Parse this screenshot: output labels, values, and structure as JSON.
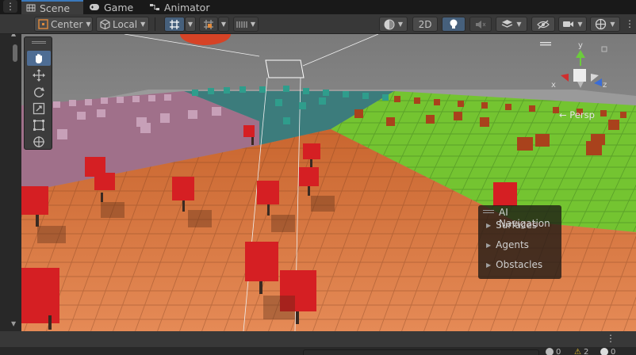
{
  "tabs": [
    {
      "label": "Scene",
      "icon": "scene-grid-icon",
      "active": true
    },
    {
      "label": "Game",
      "icon": "gamepad-icon",
      "active": false
    },
    {
      "label": "Animator",
      "icon": "animator-icon",
      "active": false
    }
  ],
  "toolbar": {
    "pivot_label": "Center",
    "space_label": "Local",
    "view2d_label": "2D"
  },
  "overlay_title": "AI Navigation",
  "nav_items": [
    "Surfaces",
    "Agents",
    "Obstacles"
  ],
  "gizmo": {
    "persp_label": "← Persp",
    "axis_x": "x",
    "axis_y": "y",
    "axis_z": "z"
  },
  "console": {
    "errors": "0",
    "warnings": "2",
    "infos": "0"
  },
  "colors": {
    "accent": "#3a79bb",
    "ground": "#d8743c",
    "grass": "#74c431",
    "purple_zone": "#a0708a",
    "teal_zone": "#3c8080",
    "tree_red": "#d51f23"
  }
}
